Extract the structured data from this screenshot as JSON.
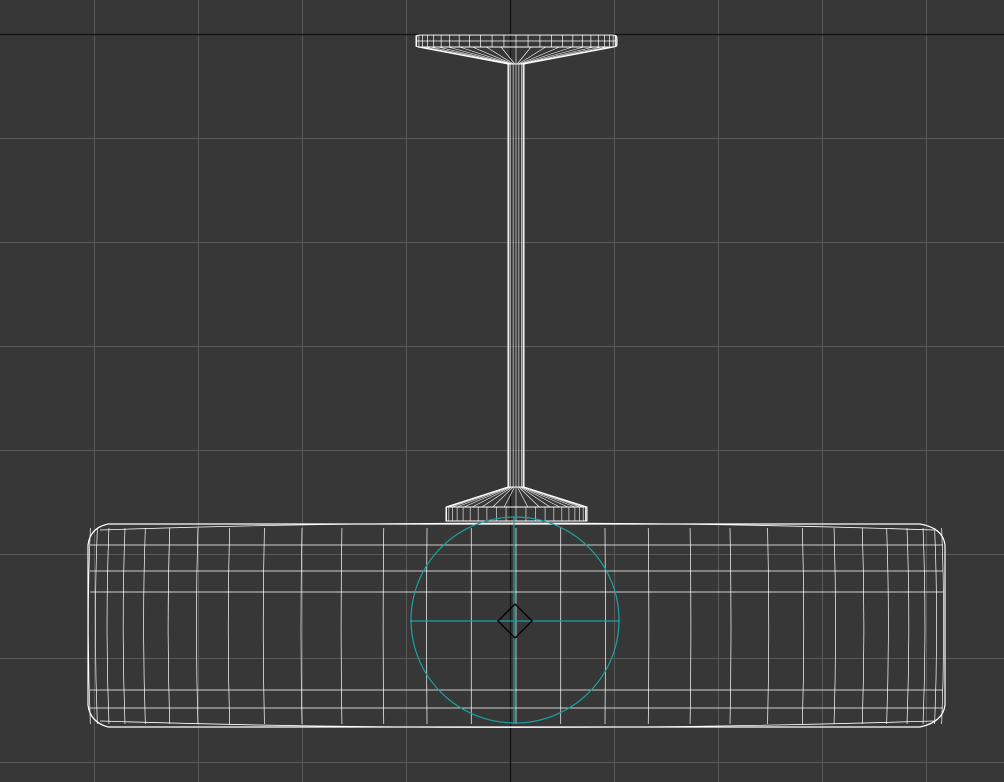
{
  "viewport": {
    "view": "front",
    "shading": "wireframe",
    "background_color": "#373737",
    "grid_color": "#5a5a5a",
    "axis_color": "#111111",
    "wire_color": "#ffffff",
    "gizmo_color": "#19a3a3",
    "grid_visible": true
  },
  "scene": {
    "object": "pendant-lamp",
    "parts": [
      "ceiling-canopy",
      "suspension-rod",
      "shade-mount",
      "lamp-shade"
    ],
    "selection": {
      "transform_gizmo": "rotate-circle-icon",
      "pivot": "pivot-diamond-icon"
    }
  }
}
